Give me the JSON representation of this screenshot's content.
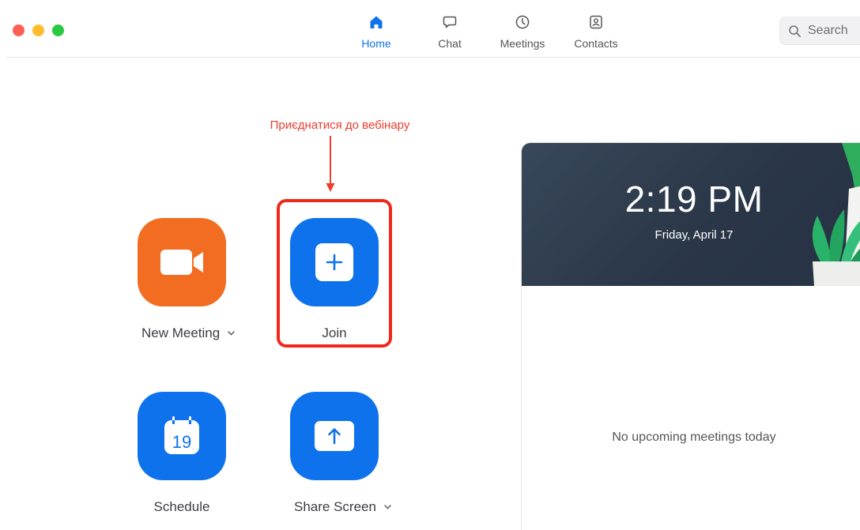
{
  "titlebar": {
    "nav": [
      {
        "label": "Home",
        "icon": "home-icon",
        "active": true
      },
      {
        "label": "Chat",
        "icon": "chat-icon",
        "active": false
      },
      {
        "label": "Meetings",
        "icon": "clock-icon",
        "active": false
      },
      {
        "label": "Contacts",
        "icon": "contacts-icon",
        "active": false
      }
    ],
    "search": {
      "placeholder": "Search",
      "icon": "search-icon"
    }
  },
  "annotation": {
    "text": "Приєднатися до вебінару",
    "color": "#ef3b2d"
  },
  "actions": {
    "new_meeting": {
      "label": "New Meeting",
      "icon": "video-camera-icon",
      "color": "#f26d21",
      "has_dropdown": true
    },
    "join": {
      "label": "Join",
      "icon": "plus-icon",
      "color": "#0e72ed",
      "has_dropdown": false
    },
    "schedule": {
      "label": "Schedule",
      "icon": "calendar-icon",
      "calendar_day": "19",
      "color": "#0e72ed",
      "has_dropdown": false
    },
    "share_screen": {
      "label": "Share Screen",
      "icon": "upload-arrow-icon",
      "color": "#0e72ed",
      "has_dropdown": true
    }
  },
  "panel": {
    "time": "2:19 PM",
    "date": "Friday, April 17",
    "empty_message": "No upcoming meetings today"
  },
  "colors": {
    "accent": "#0e72ed",
    "orange": "#f26d21",
    "header_bg": "#2f3c4e"
  }
}
